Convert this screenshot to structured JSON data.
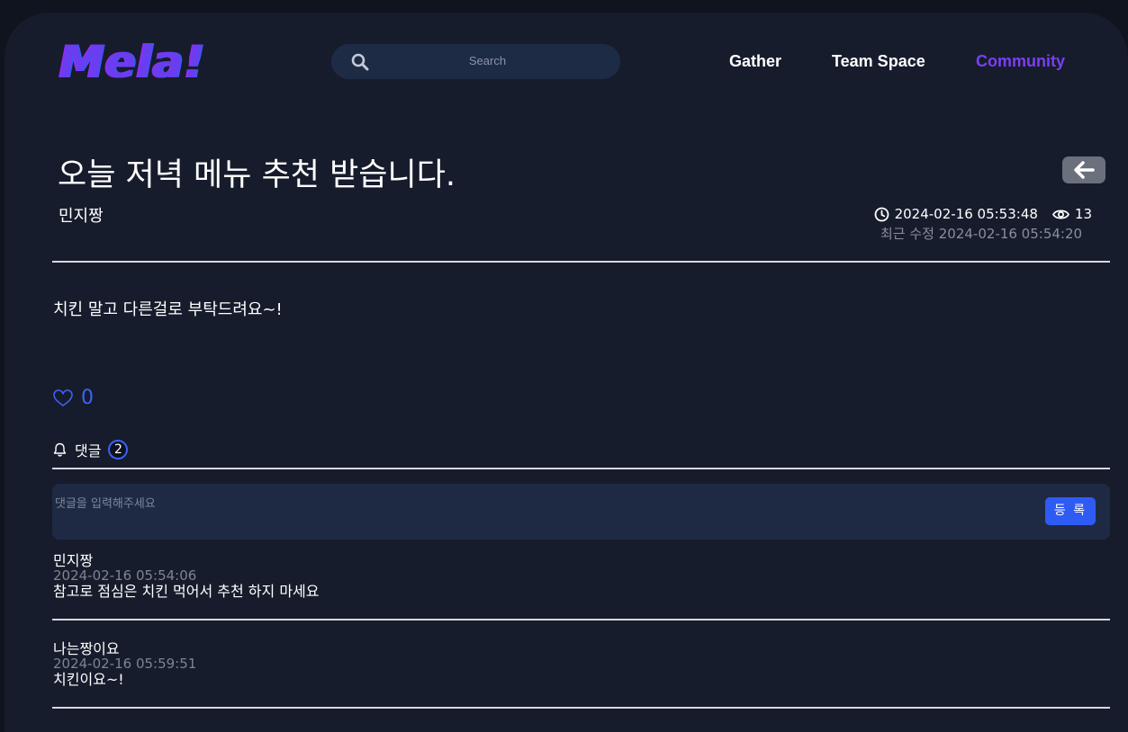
{
  "header": {
    "logo": "Mela!",
    "search_placeholder": "Search",
    "nav": [
      {
        "label": "Gather",
        "active": false
      },
      {
        "label": "Team Space",
        "active": false
      },
      {
        "label": "Community",
        "active": true
      }
    ]
  },
  "post": {
    "title": "오늘 저녁 메뉴 추천 받습니다.",
    "author": "민지짱",
    "created": "2024-02-16 05:53:48",
    "views": "13",
    "modified": "최근 수정 2024-02-16 05:54:20",
    "body": "치킨 말고 다른걸로 부탁드려요~!",
    "likes": "0"
  },
  "comments_section": {
    "label": "댓글",
    "count": "2",
    "input_placeholder": "댓글을 입력해주세요",
    "submit_label": "등 록"
  },
  "comments": [
    {
      "author": "민지짱",
      "date": "2024-02-16 05:54:06",
      "text": "참고로 점심은 치킨 먹어서 추천 하지 마세요"
    },
    {
      "author": "나는짱이요",
      "date": "2024-02-16 05:59:51",
      "text": "치킨이요~!"
    }
  ],
  "colors": {
    "background": "#161c2c",
    "accent": "#7b3ff2",
    "primary": "#2f5bf5"
  },
  "icons": [
    "search-icon",
    "back-arrow-icon",
    "clock-icon",
    "eye-icon",
    "heart-icon",
    "bell-icon"
  ]
}
